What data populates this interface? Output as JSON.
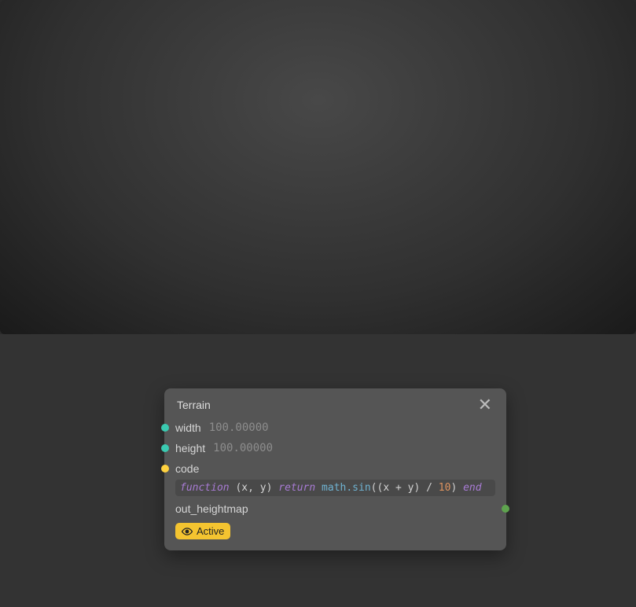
{
  "node": {
    "title": "Terrain",
    "params": {
      "width": {
        "label": "width",
        "value": "100.00000"
      },
      "height": {
        "label": "height",
        "value": "100.00000"
      },
      "code": {
        "label": "code"
      },
      "code_src": {
        "kw1": "function",
        "args_open": "(",
        "arg1": "x",
        "comma1": ", ",
        "arg2": "y",
        "args_close": ")",
        "kw2": "return",
        "fn": "math.sin",
        "expr_open": "((",
        "var1": "x",
        "plus": " + ",
        "var2": "y",
        "expr_mid": ") / ",
        "num": "10",
        "expr_close": ")",
        "kw3": "end"
      },
      "out_label": "out_heightmap"
    },
    "active_label": "Active"
  },
  "colors": {
    "port_teal": "#3ac9b0",
    "port_yellow": "#ffd23f",
    "port_out": "#5ea34e",
    "axis_x": "#ff6a6a",
    "axis_z": "#6a7dff",
    "badge": "#f4c430"
  }
}
